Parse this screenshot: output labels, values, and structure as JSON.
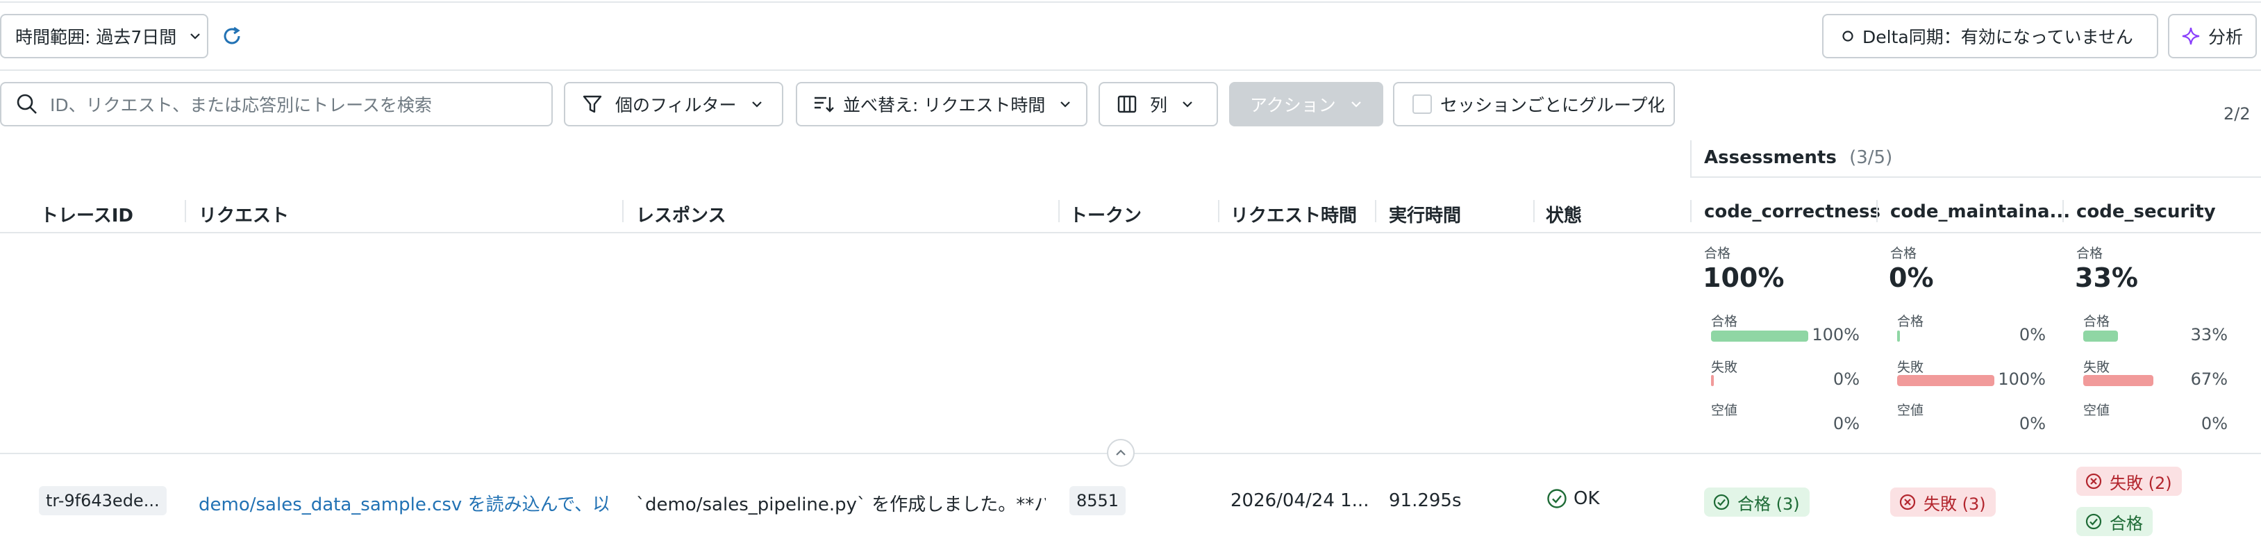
{
  "toolbar": {
    "time_range_label": "時間範囲: 過去7日間",
    "delta_sync_label": "Delta同期：有効になっていません",
    "analyze_label": "分析"
  },
  "filters": {
    "search_placeholder": "ID、リクエスト、または応答別にトレースを検索",
    "filter_label": "個のフィルター",
    "sort_label": "並べ替え: リクエスト時間",
    "columns_label": "列",
    "actions_label": "アクション",
    "group_by_session_label": "セッションごとにグループ化",
    "page_indicator": "2/2"
  },
  "assessments": {
    "title": "Assessments",
    "count": "(3/5)"
  },
  "columns": {
    "trace_id": "トレースID",
    "request": "リクエスト",
    "response": "レスポンス",
    "tokens": "トークン",
    "request_time": "リクエスト時間",
    "execution_time": "実行時間",
    "state": "状態",
    "code_correctness": "code_correctness",
    "code_maintainability": "code_maintaina...",
    "code_security": "code_security"
  },
  "summary": {
    "pass_caption": "合格",
    "fail_caption": "失敗",
    "null_caption": "空値",
    "correctness": {
      "pass_rate": "100%",
      "pass_pct": "100%",
      "fail_pct": "0%",
      "null_pct": "0%",
      "pass_fraction": 1.0,
      "fail_fraction": 0.0
    },
    "maintainability": {
      "pass_rate": "0%",
      "pass_pct": "0%",
      "fail_pct": "100%",
      "null_pct": "0%",
      "pass_fraction": 0.0,
      "fail_fraction": 1.0
    },
    "security": {
      "pass_rate": "33%",
      "pass_pct": "33%",
      "fail_pct": "67%",
      "null_pct": "0%",
      "pass_fraction": 0.33,
      "fail_fraction": 0.67
    }
  },
  "rows": [
    {
      "trace_id": "tr-9f643ede...",
      "request": "demo/sales_data_sample.csv を読み込んで、以...",
      "response": "`demo/sales_pipeline.py` を作成しました。**パ...",
      "tokens": "8551",
      "request_time": "2026/04/24 1...",
      "execution_time": "91.295s",
      "state": "OK",
      "correctness_badge": "合格 (3)",
      "maintainability_badge": "失敗 (3)",
      "security_badge_fail": "失敗 (2)",
      "security_badge_pass": "合格"
    }
  ],
  "colors": {
    "link": "#2272b4",
    "pass_bar": "#8fd6a4",
    "fail_bar": "#f19a9a",
    "pass_badge_bg": "#e2f5e7",
    "fail_badge_bg": "#fbe1e3"
  }
}
